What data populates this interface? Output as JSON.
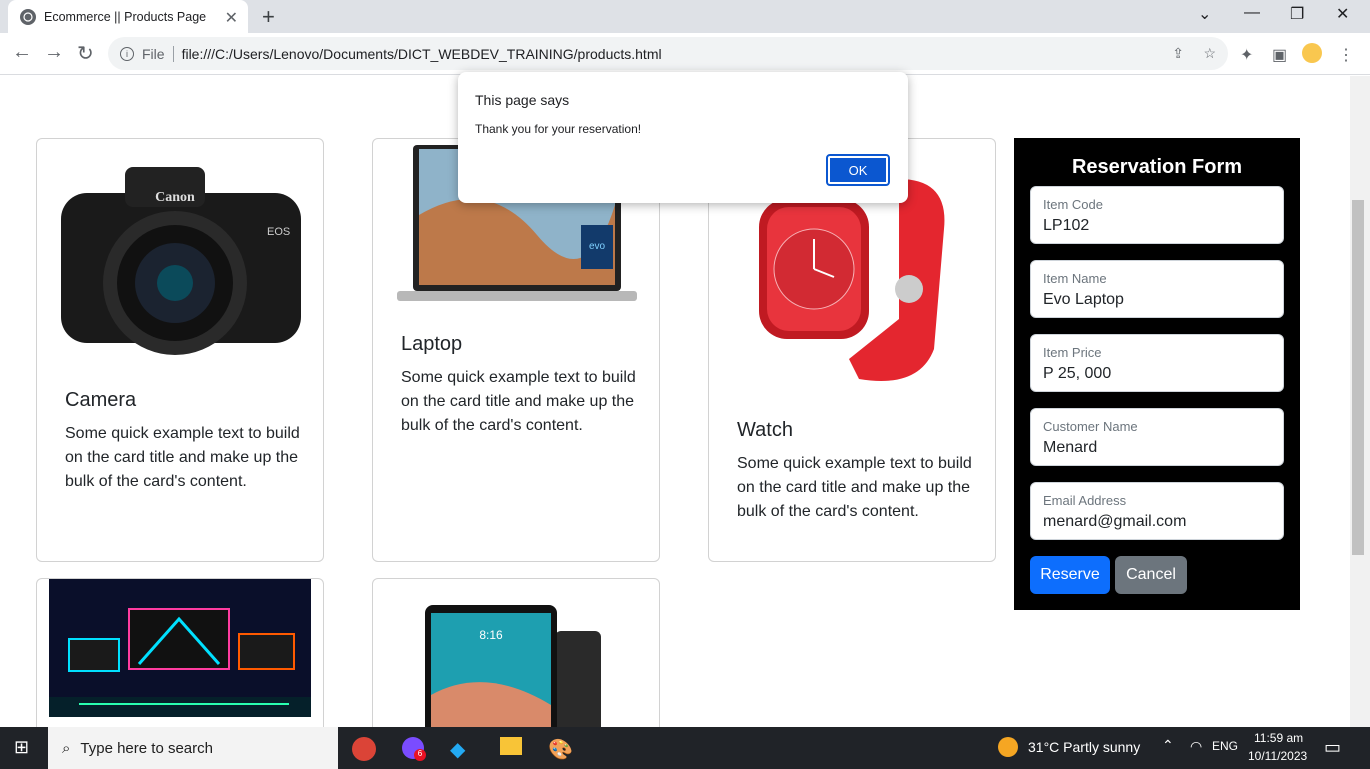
{
  "browser": {
    "tab_title": "Ecommerce || Products Page",
    "url": "file:///C:/Users/Lenovo/Documents/DICT_WEBDEV_TRAINING/products.html",
    "file_label": "File"
  },
  "cards": [
    {
      "title": "Camera",
      "text": "Some quick example text to build on the card title and make up the bulk of the card's content."
    },
    {
      "title": "Laptop",
      "text": "Some quick example text to build on the card title and make up the bulk of the card's content."
    },
    {
      "title": "Watch",
      "text": "Some quick example text to build on the card title and make up the bulk of the card's content."
    }
  ],
  "form": {
    "title": "Reservation Form",
    "fields": [
      {
        "label": "Item Code",
        "value": "LP102"
      },
      {
        "label": "Item Name",
        "value": "Evo Laptop"
      },
      {
        "label": "Item Price",
        "value": "P 25, 000"
      },
      {
        "label": "Customer Name",
        "value": "Menard"
      },
      {
        "label": "Email Address",
        "value": "menard@gmail.com"
      }
    ],
    "reserve_label": "Reserve",
    "cancel_label": "Cancel",
    "reserve_color": "#0d6efd",
    "cancel_color": "#6c757d"
  },
  "dialog": {
    "heading": "This page says",
    "message": "Thank you for your reservation!",
    "ok_label": "OK"
  },
  "taskbar": {
    "search_placeholder": "Type here to search",
    "weather": "31°C  Partly sunny",
    "lang": "ENG",
    "time": "11:59 am",
    "date": "10/11/2023",
    "badge": "6"
  }
}
